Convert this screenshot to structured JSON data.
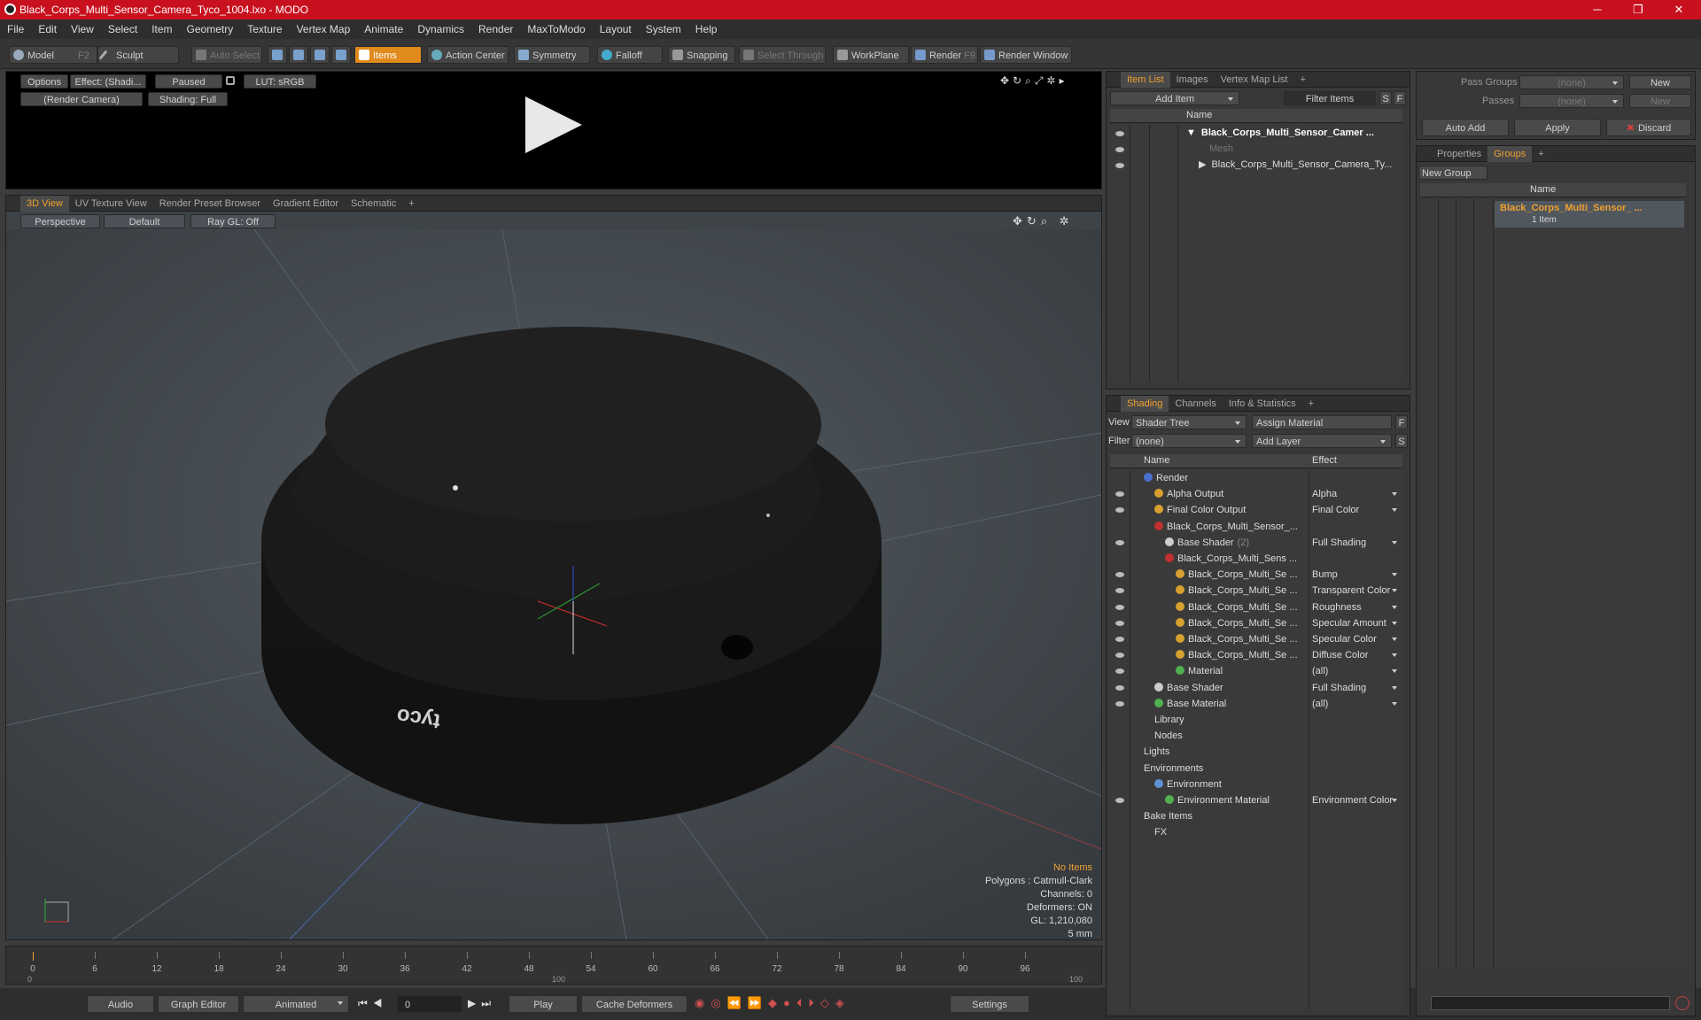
{
  "window": {
    "title": "Black_Corps_Multi_Sensor_Camera_Tyco_1004.lxo - MODO",
    "min": "─",
    "max": "❐",
    "close": "✕"
  },
  "menu": [
    "File",
    "Edit",
    "View",
    "Select",
    "Item",
    "Geometry",
    "Texture",
    "Vertex Map",
    "Animate",
    "Dynamics",
    "Render",
    "MaxToModo",
    "Layout",
    "System",
    "Help"
  ],
  "toolbar": {
    "model": "Model",
    "model_key": "F2",
    "sculpt": "Sculpt",
    "auto_select": "Auto Select",
    "items": "Items",
    "action_center": "Action Center",
    "symmetry": "Symmetry",
    "falloff": "Falloff",
    "snapping": "Snapping",
    "select_through": "Select Through",
    "workplane": "WorkPlane",
    "render": "Render",
    "render_key": "F9",
    "render_window": "Render Window"
  },
  "preview": {
    "options": "Options",
    "effect": "Effect: (Shadi...",
    "paused": "Paused",
    "lut": "LUT: sRGB",
    "camera": "(Render Camera)",
    "shading": "Shading: Full"
  },
  "viewport": {
    "tabs": [
      "3D View",
      "UV Texture View",
      "Render Preset Browser",
      "Gradient Editor",
      "Schematic",
      "+"
    ],
    "perspective": "Perspective",
    "default": "Default",
    "raygl": "Ray GL: Off",
    "logo_text": "tyco",
    "no_items": "No Items",
    "polygons": "Polygons : Catmull-Clark",
    "channels": "Channels: 0",
    "deformers": "Deformers: ON",
    "gl": "GL: 1,210,080",
    "scale": "5 mm"
  },
  "timeline": {
    "ticks": [
      "0",
      "6",
      "12",
      "18",
      "24",
      "30",
      "36",
      "42",
      "48",
      "54",
      "60",
      "66",
      "72",
      "78",
      "84",
      "90",
      "96"
    ],
    "start": "0",
    "mid": "100",
    "end": "100"
  },
  "bottombar": {
    "audio": "Audio",
    "graph_editor": "Graph Editor",
    "animated": "Animated",
    "frame": "0",
    "play": "Play",
    "cache_deformers": "Cache Deformers",
    "settings": "Settings"
  },
  "itemlist": {
    "tabs": [
      "Item List",
      "Images",
      "Vertex Map List",
      "+"
    ],
    "add_item": "Add Item",
    "filter_items": "Filter Items",
    "s": "S",
    "f": "F",
    "col_name": "Name",
    "rows": [
      "Black_Corps_Multi_Sensor_Camer ...",
      "Mesh",
      "Black_Corps_Multi_Sensor_Camera_Ty..."
    ]
  },
  "shading": {
    "tabs": [
      "Shading",
      "Channels",
      "Info & Statistics",
      "+"
    ],
    "view_label": "View",
    "view_value": "Shader Tree",
    "assign_material": "Assign Material",
    "filter_label": "Filter",
    "filter_value": "(none)",
    "add_layer": "Add Layer",
    "f": "F",
    "s": "S",
    "col_name": "Name",
    "col_effect": "Effect",
    "rows": [
      {
        "name": "Render",
        "effect": "",
        "indent": 0,
        "color": "#4a6fd0"
      },
      {
        "name": "Alpha Output",
        "effect": "Alpha",
        "indent": 1,
        "color": "#d8a030"
      },
      {
        "name": "Final Color Output",
        "effect": "Final Color",
        "indent": 1,
        "color": "#d8a030"
      },
      {
        "name": "Black_Corps_Multi_Sensor_...",
        "effect": "",
        "indent": 1,
        "color": "#c03030"
      },
      {
        "name": "Base Shader",
        "effect": "Full Shading",
        "indent": 2,
        "color": "#cccccc",
        "extra": "(2)"
      },
      {
        "name": "Black_Corps_Multi_Sens ...",
        "effect": "",
        "indent": 2,
        "color": "#c03030"
      },
      {
        "name": "Black_Corps_Multi_Se ...",
        "effect": "Bump",
        "indent": 3,
        "color": "#d8a030"
      },
      {
        "name": "Black_Corps_Multi_Se ...",
        "effect": "Transparent Color",
        "indent": 3,
        "color": "#d8a030"
      },
      {
        "name": "Black_Corps_Multi_Se ...",
        "effect": "Roughness",
        "indent": 3,
        "color": "#d8a030"
      },
      {
        "name": "Black_Corps_Multi_Se ...",
        "effect": "Specular Amount",
        "indent": 3,
        "color": "#d8a030"
      },
      {
        "name": "Black_Corps_Multi_Se ...",
        "effect": "Specular Color",
        "indent": 3,
        "color": "#d8a030"
      },
      {
        "name": "Black_Corps_Multi_Se ...",
        "effect": "Diffuse Color",
        "indent": 3,
        "color": "#d8a030"
      },
      {
        "name": "Material",
        "effect": "(all)",
        "indent": 3,
        "color": "#50b050"
      },
      {
        "name": "Base Shader",
        "effect": "Full Shading",
        "indent": 1,
        "color": "#cccccc"
      },
      {
        "name": "Base Material",
        "effect": "(all)",
        "indent": 1,
        "color": "#50b050"
      },
      {
        "name": "Library",
        "effect": "",
        "indent": 1,
        "color": ""
      },
      {
        "name": "Nodes",
        "effect": "",
        "indent": 1,
        "color": ""
      },
      {
        "name": "Lights",
        "effect": "",
        "indent": 0,
        "color": ""
      },
      {
        "name": "Environments",
        "effect": "",
        "indent": 0,
        "color": ""
      },
      {
        "name": "Environment",
        "effect": "",
        "indent": 1,
        "color": "#6090d0"
      },
      {
        "name": "Environment Material",
        "effect": "Environment Color",
        "indent": 2,
        "color": "#50b050"
      },
      {
        "name": "Bake Items",
        "effect": "",
        "indent": 0,
        "color": ""
      },
      {
        "name": "FX",
        "effect": "",
        "indent": 1,
        "color": ""
      }
    ]
  },
  "right": {
    "pass_groups": "Pass Groups",
    "passes": "Passes",
    "none": "(none)",
    "new": "New",
    "auto_add": "Auto Add",
    "apply": "Apply",
    "discard": "Discard",
    "tabs": [
      "Properties",
      "Groups",
      "+"
    ],
    "new_group": "New Group",
    "col_name": "Name",
    "group_name": "Black_Corps_Multi_Sensor_ ...",
    "group_count": "1 Item"
  }
}
